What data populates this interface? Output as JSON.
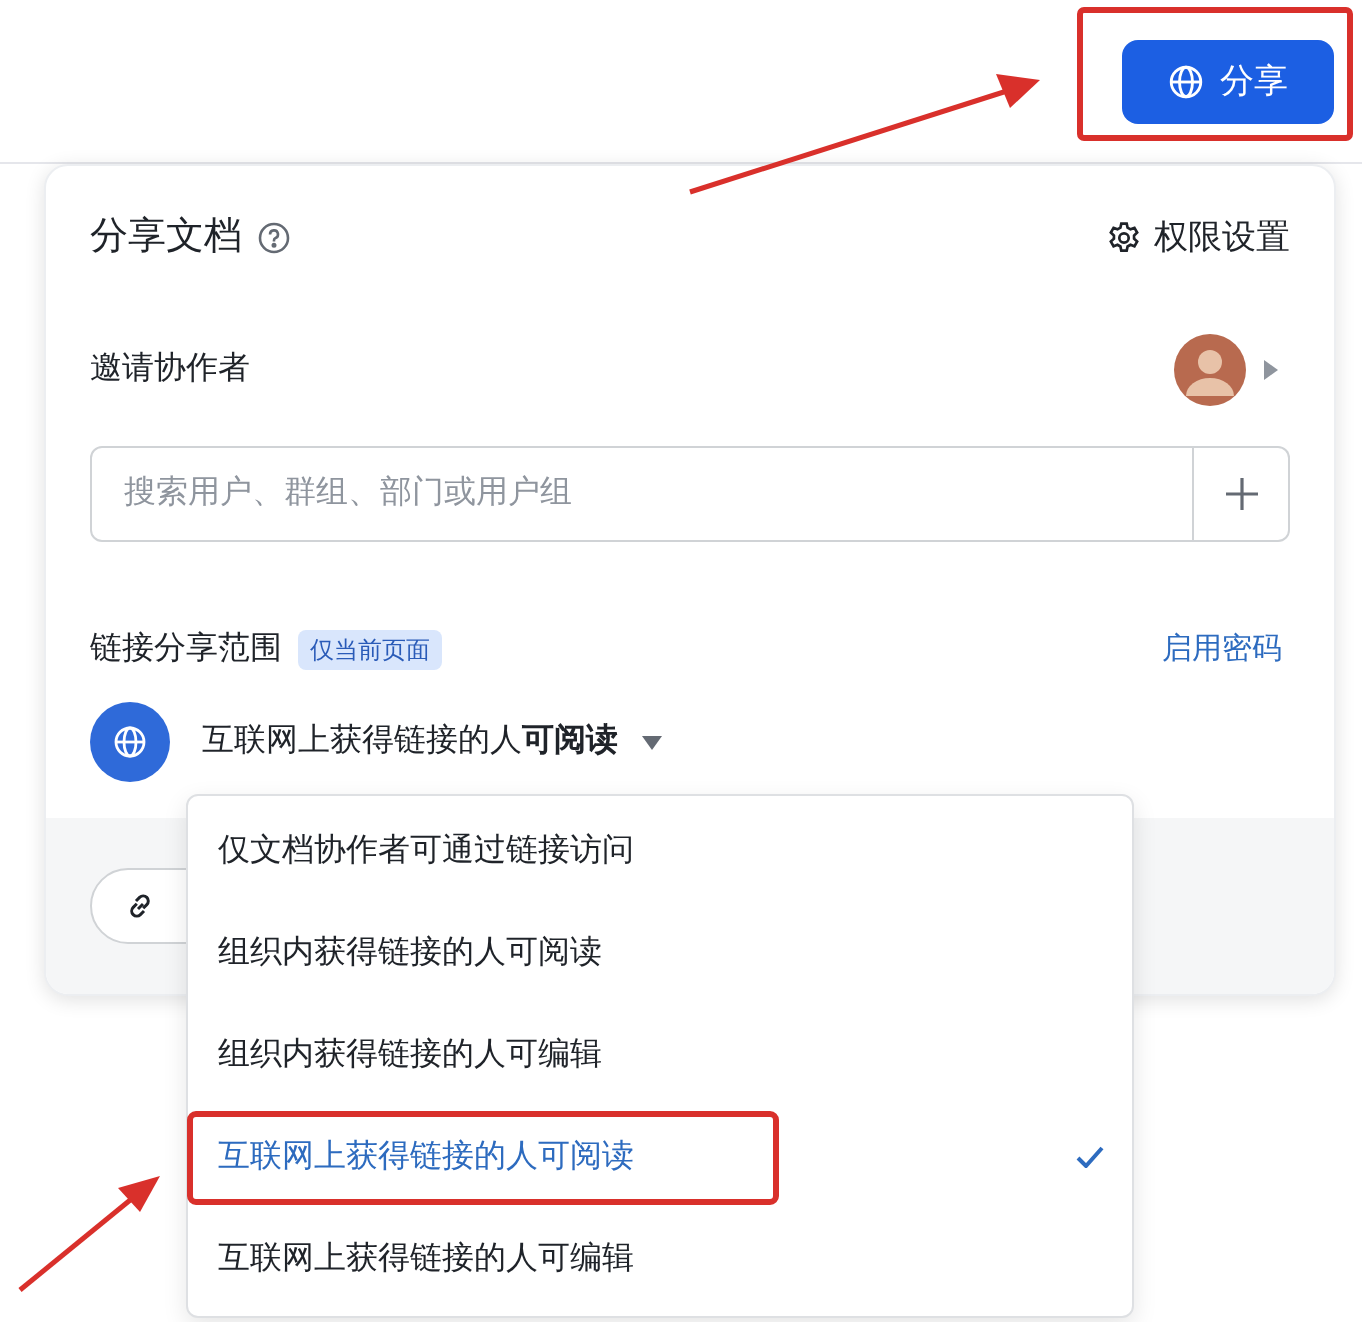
{
  "share_button": {
    "label": "分享"
  },
  "panel": {
    "title": "分享文档",
    "settings_link": "权限设置",
    "invite": {
      "label": "邀请协作者",
      "search": {
        "placeholder": "搜索用户、群组、部门或用户组"
      }
    },
    "link_scope": {
      "label": "链接分享范围",
      "badge": "仅当前页面",
      "password_link": "启用密码",
      "current": "互联网上获得链接的人**可阅读**"
    }
  },
  "dropdown": [
    {
      "label": "仅文档协作者可通过链接访问",
      "selected": false
    },
    {
      "label": "组织内获得链接的人可阅读",
      "selected": false
    },
    {
      "label": "组织内获得链接的人可编辑",
      "selected": false
    },
    {
      "label": "互联网上获得链接的人可阅读",
      "selected": true
    },
    {
      "label": "互联网上获得链接的人可编辑",
      "selected": false
    }
  ]
}
